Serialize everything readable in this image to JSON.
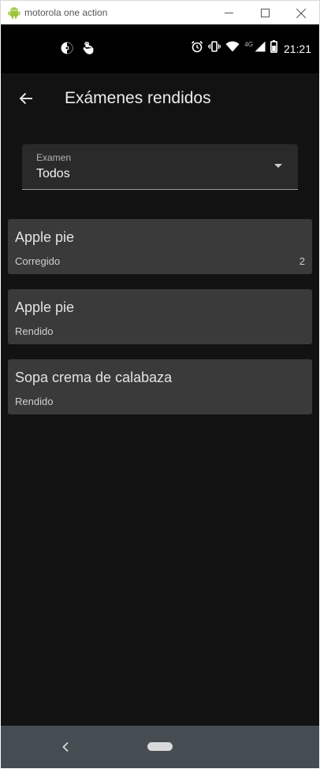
{
  "window": {
    "title": "motorola one action",
    "icon": "android-robot-icon",
    "controls": [
      "minimize-icon",
      "maximize-icon",
      "close-icon"
    ]
  },
  "statusbar": {
    "left_icons": [
      "pokemon-ball-icon",
      "hand-touch-icon"
    ],
    "right_icons": [
      "alarm-icon",
      "vibrate-icon",
      "wifi-icon",
      "signal-icon",
      "battery-icon"
    ],
    "network": "4G",
    "time": "21:21"
  },
  "appbar": {
    "title": "Exámenes rendidos",
    "back_icon": "arrow-back-icon"
  },
  "filter": {
    "label": "Examen",
    "value": "Todos"
  },
  "exams": [
    {
      "title": "Apple pie",
      "status": "Corregido",
      "count": "2"
    },
    {
      "title": "Apple pie",
      "status": "Rendido",
      "count": ""
    },
    {
      "title": "Sopa crema de calabaza",
      "status": "Rendido",
      "count": ""
    }
  ],
  "navbar": {
    "back_icon": "nav-back-icon",
    "home_icon": "home-pill-icon"
  },
  "colors": {
    "background": "#121212",
    "card": "#3a3a3a",
    "navbar": "#454d52",
    "statusbar": "#000000"
  }
}
